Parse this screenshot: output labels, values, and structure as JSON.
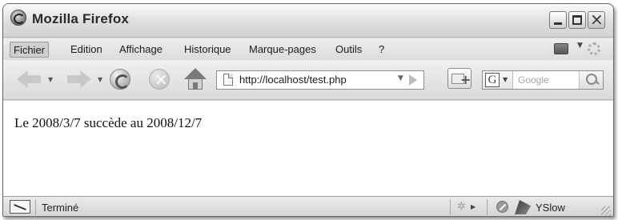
{
  "window": {
    "title": "Mozilla Firefox"
  },
  "menubar": {
    "items": [
      {
        "label": "Fichier"
      },
      {
        "label": "Edition"
      },
      {
        "label": "Affichage"
      },
      {
        "label": "Historique"
      },
      {
        "label": "Marque-pages"
      },
      {
        "label": "Outils"
      },
      {
        "label": "?"
      }
    ]
  },
  "navbar": {
    "url": "http://localhost/test.php",
    "search_placeholder": "Google",
    "search_engine_letter": "G"
  },
  "content": {
    "text": "Le 2008/3/7 succède au 2008/12/7"
  },
  "statusbar": {
    "status": "Terminé",
    "yslow_label": "YSlow"
  },
  "icons": {
    "app": "firefox-logo-icon",
    "back": "back-arrow-icon",
    "forward": "forward-arrow-icon",
    "reload": "reload-icon",
    "stop": "stop-icon",
    "home": "home-icon",
    "page": "page-icon",
    "go": "go-arrow-icon",
    "bookmark": "bookmark-add-icon",
    "search": "magnifier-icon",
    "status": "connection-icon",
    "noentry": "blocked-icon",
    "yslow": "yslow-icon"
  },
  "colors": {
    "chrome": "#d8d8d8",
    "content_bg": "#ffffff",
    "text": "#111111",
    "placeholder": "#a5a5a5"
  }
}
